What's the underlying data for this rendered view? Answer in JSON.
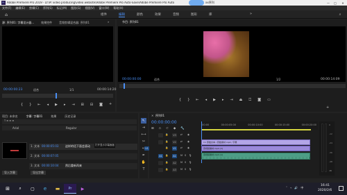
{
  "window": {
    "title": "Adobe Premiere Pro 2019 - D:\\Pr video producing\\video website\\Adobe Premiere Pro Auto-Save\\Adobe Premiere Pro Auto",
    "title_suffix": "xx序列",
    "controls": [
      "—",
      "□",
      "✕"
    ]
  },
  "menubar": {
    "items": [
      "文件(F)",
      "编辑(E)",
      "剪辑(C)",
      "序列(S)",
      "标记(M)",
      "图形(G)",
      "视图(V)",
      "窗口(W)",
      "帮助(H)"
    ]
  },
  "workspaces": {
    "items": [
      "组件",
      "编辑",
      "颜色",
      "效果",
      "音频",
      "图形",
      "库"
    ],
    "active_index": 1,
    "overflow": "»"
  },
  "source_monitor": {
    "tabs": [
      "源: 序列01: 字幕设计器...",
      "效果控件",
      "音频剪辑混合器: 序列01"
    ],
    "timecode": "00:00:00:23",
    "fit": "适合",
    "resolution": "1/1",
    "duration": "00:00:14:20"
  },
  "program_monitor": {
    "tab": "节目: 序列01",
    "timecode": "00:00:00:00",
    "fit": "适合",
    "resolution": "1/2",
    "duration": "00:00:14:09"
  },
  "text_panel": {
    "tabs": [
      "项目: 未命名",
      "字幕: 字幕01",
      "效果",
      "历史记录"
    ],
    "font": "Arial",
    "style": "Regular",
    "rows": [
      {
        "label": "1. 文本",
        "time": "00:00:05:03",
        "text": "这样的话下面会滚动",
        "tooltip": "打开显示字幕面板"
      },
      {
        "label": "2. 文本",
        "time": "00:00:07:05",
        "text": "",
        "tooltip": ""
      },
      {
        "label": "3. 文本",
        "time": "00:00:10:04",
        "text": "然后重新再来",
        "tooltip": ""
      }
    ],
    "footer_buttons": [
      "导入字幕",
      "导出字幕"
    ]
  },
  "timeline": {
    "tab": "序列01",
    "timecode": "00:00:00:00",
    "ruler_labels": [
      ":00:00",
      "00:00:05:00",
      "00:00:10:00",
      "00:00:15:00",
      "00:00:20:00"
    ],
    "tracks": [
      {
        "name": "V3",
        "target": false
      },
      {
        "name": "V2",
        "target": false
      },
      {
        "name": "V1",
        "target": true
      },
      {
        "name": "A1",
        "target": true
      },
      {
        "name": "A2",
        "target": false
      },
      {
        "name": "A3",
        "target": false
      }
    ],
    "clips": [
      {
        "track": "V2",
        "label": "C1 原始文本 / 原始素材.mp4 / 字幕"
      },
      {
        "track": "V1",
        "label": "原视频素材.mp4 [V]"
      },
      {
        "track": "A1",
        "label": "原视频素材.mp4 [A]"
      }
    ],
    "audio_meter_labels": [
      "0",
      "-12",
      "-24",
      "-36",
      "-48",
      "dB"
    ]
  },
  "taskbar": {
    "time": "16:41",
    "date": "2020/2/6",
    "apps": [
      "windows-start",
      "search",
      "task-view",
      "edge",
      "explorer",
      "premiere",
      "media"
    ]
  },
  "colors": {
    "timecode_blue": "#4a8ff5",
    "video_clip": "#9b8ad9",
    "audio_clip": "#4d9d86",
    "accent": "#4a8ff5"
  }
}
